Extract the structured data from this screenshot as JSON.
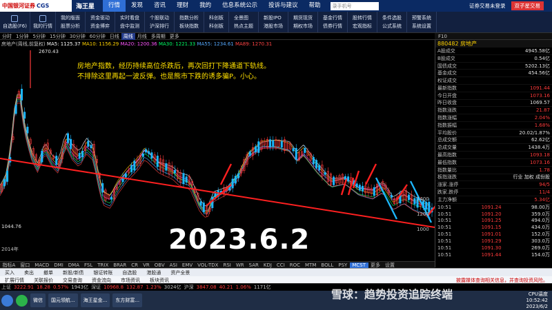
{
  "app": {
    "logo_text": "中国银河证券",
    "logo_suffix": "CGS",
    "name": "海王星",
    "search_placeholder": "录手机号",
    "login_link": "证券交易未登录",
    "dual_button": "双子星交易"
  },
  "menu": [
    "行情",
    "发现",
    "咨讯",
    "理财",
    "我的",
    "信息系统公示",
    "投诉与建议",
    "帮助"
  ],
  "toolbar": {
    "singles": [
      {
        "label": "自选股(F6)"
      },
      {
        "label": "我的行情"
      }
    ],
    "pairs": [
      [
        "我的版面",
        "股票分析"
      ],
      [
        "资金驱动",
        "资金博弈"
      ],
      [
        "实时看盘",
        "盘中监测"
      ],
      [
        "个股联动",
        "沪深排行"
      ],
      [
        "指数分析",
        "板块指数"
      ],
      [
        "科创板",
        "科创板"
      ],
      [
        "全景图",
        "热点主题"
      ],
      [
        "新股IPO",
        "港股市场"
      ],
      [
        "期货现货",
        "期权市场"
      ],
      [
        "基金行情",
        "债券行情"
      ],
      [
        "股转行情",
        "宏观指标"
      ],
      [
        "条件选股",
        "公式系统"
      ],
      [
        "预警系统",
        "系统设置"
      ]
    ]
  },
  "periods": [
    "分时",
    "1分钟",
    "5分钟",
    "15分钟",
    "30分钟",
    "60分钟",
    "日线",
    "周线",
    "月线",
    "多周期",
    "更多"
  ],
  "active_period": "周线",
  "right_tabs": [
    "F10"
  ],
  "ma_legend": {
    "title": "房地产(周线,前复权)",
    "items": [
      {
        "text": "MA5: 1125.37",
        "color": "#ffffff"
      },
      {
        "text": "MA10: 1156.29",
        "color": "#ffd200"
      },
      {
        "text": "MA20: 1200.36",
        "color": "#ff55ff"
      },
      {
        "text": "MA30: 1221.33",
        "color": "#00ff66"
      },
      {
        "text": "MA55: 1234.61",
        "color": "#55aaff"
      },
      {
        "text": "MA89: 1270.31",
        "color": "#ff4444"
      }
    ]
  },
  "chart": {
    "price_high_label": "2670.43",
    "price_low_label": "1044.76",
    "year_label": "2014年",
    "right_axis": [
      "1400",
      "1200",
      "1000"
    ],
    "up_color": "#ff3b3b",
    "down_color": "#1db7ff",
    "trend_color": "#ff2020"
  },
  "notes": [
    "房地产指数，经历持续高位杀跌后，再次回打下降通道下轨线。",
    "不排除这里再起一波反弹。也是熊市下跌的诱多骗P。小心。"
  ],
  "date_stamp": "2023.6.2",
  "indicators": [
    "指标A",
    "窗口",
    "MACD",
    "DMI",
    "DMA",
    "FSL",
    "TRIX",
    "BRAR",
    "CR",
    "VR",
    "OBV",
    "ASI",
    "EMV",
    "VOL-TDX",
    "RSI",
    "WR",
    "SAR",
    "KDJ",
    "CCI",
    "ROC",
    "MTM",
    "BOLL",
    "PSY",
    "MCST",
    "更多",
    "设置"
  ],
  "active_indicator": "MCST",
  "quote": {
    "code_title": "880482 房地产",
    "rows": [
      {
        "label": "A股成交",
        "value": "4945.58亿",
        "cls": "white"
      },
      {
        "label": "B股成交",
        "value": "0.54亿",
        "cls": "white"
      },
      {
        "label": "国债成交",
        "value": "5202.13亿",
        "cls": "white"
      },
      {
        "label": "基金成交",
        "value": "454.56亿",
        "cls": "white"
      },
      {
        "label": "权证成交",
        "value": "",
        "cls": "white"
      },
      {
        "label": "最新指数",
        "value": "1091.44",
        "cls": "red"
      },
      {
        "label": "今日开盘",
        "value": "1073.16",
        "cls": "red"
      },
      {
        "label": "昨日收盘",
        "value": "1069.57",
        "cls": "white"
      },
      {
        "label": "指数涨跌",
        "value": "21.87",
        "cls": "red"
      },
      {
        "label": "指数涨幅",
        "value": "2.04%",
        "cls": "red"
      },
      {
        "label": "指数振幅",
        "value": "1.68%",
        "cls": "red"
      },
      {
        "label": "平均股价",
        "value": "20.02/1.87%",
        "cls": "white"
      },
      {
        "label": "总成交额",
        "value": "62.62亿",
        "cls": "white"
      },
      {
        "label": "总成交量",
        "value": "1438.4万",
        "cls": "white"
      },
      {
        "label": "最高指数",
        "value": "1093.18",
        "cls": "red"
      },
      {
        "label": "最低指数",
        "value": "1073.16",
        "cls": "red"
      },
      {
        "label": "指数量比",
        "value": "1.78",
        "cls": "red"
      },
      {
        "label": "板指涨跌",
        "value": "行业 加权 成份股",
        "cls": "white"
      },
      {
        "label": "涨家.涨停",
        "value": "94/5",
        "cls": "red"
      },
      {
        "label": "跌家.跌停",
        "value": "11/4",
        "cls": "red"
      },
      {
        "label": "主力净额",
        "value": "5.34亿",
        "cls": "red"
      }
    ],
    "ticks": [
      {
        "t": "10:51",
        "p": "1091.24",
        "v": "98.00万"
      },
      {
        "t": "10:51",
        "p": "1091.20",
        "v": "359.0万"
      },
      {
        "t": "10:51",
        "p": "1091.25",
        "v": "494.0万"
      },
      {
        "t": "10:51",
        "p": "1091.15",
        "v": "434.0万"
      },
      {
        "t": "10:51",
        "p": "1091.01",
        "v": "152.0万"
      },
      {
        "t": "10:51",
        "p": "1091.29",
        "v": "303.0万"
      },
      {
        "t": "10:51",
        "p": "1091.30",
        "v": "269.0万"
      },
      {
        "t": "10:51",
        "p": "1091.44",
        "v": "154.0万"
      }
    ]
  },
  "bottom_tools": {
    "row1": [
      "买入",
      "卖出",
      "撤单",
      "新股/新债",
      "银证转账",
      "自选股",
      "港股通",
      "资产全景"
    ],
    "row2": [
      "扩展行情",
      "关联报价",
      "交易查询",
      "资金流向",
      "市场资讯",
      "板块资讯"
    ],
    "news": "披露媒体查询相关信息，并查询投资风险。"
  },
  "status": [
    {
      "text": "上证",
      "cls": ""
    },
    {
      "text": "3222.91",
      "cls": "red"
    },
    {
      "text": "18.28",
      "cls": "red"
    },
    {
      "text": "0.57%",
      "cls": "red"
    },
    {
      "text": "1943亿",
      "cls": ""
    },
    {
      "text": "深证",
      "cls": ""
    },
    {
      "text": "10968.8",
      "cls": "red"
    },
    {
      "text": "132.87",
      "cls": "red"
    },
    {
      "text": "1.23%",
      "cls": "red"
    },
    {
      "text": "3024亿",
      "cls": ""
    },
    {
      "text": "沪深",
      "cls": ""
    },
    {
      "text": "3847.08",
      "cls": "red"
    },
    {
      "text": "40.21",
      "cls": "red"
    },
    {
      "text": "1.06%",
      "cls": "red"
    },
    {
      "text": "1171亿",
      "cls": ""
    }
  ],
  "taskbar": {
    "tasks": [
      "微信",
      "国元领航...",
      "海王星金...",
      "东方财富..."
    ],
    "cpu": "CPU温度",
    "time": "10:52:42",
    "date": "2023/6/2"
  },
  "watermark": "雪球：趋势投资追踪终端"
}
